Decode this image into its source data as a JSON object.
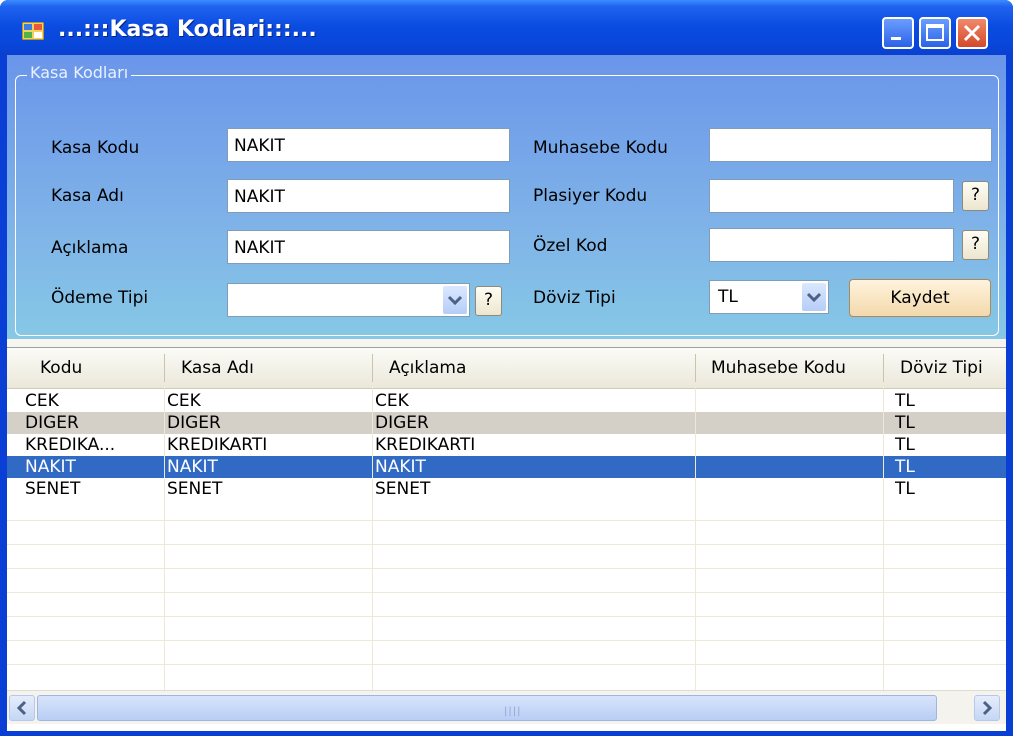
{
  "window": {
    "title": "...:::Kasa Kodlari:::..."
  },
  "group": {
    "legend": "Kasa Kodları"
  },
  "form": {
    "kasa_kodu_label": "Kasa Kodu",
    "kasa_kodu_value": "NAKIT",
    "kasa_adi_label": "Kasa Adı",
    "kasa_adi_value": "NAKIT",
    "aciklama_label": "Açıklama",
    "aciklama_value": "NAKIT",
    "odeme_tipi_label": "Ödeme Tipi",
    "odeme_tipi_value": "",
    "muhasebe_kodu_label": "Muhasebe Kodu",
    "muhasebe_kodu_value": "",
    "plasiyer_kodu_label": "Plasiyer Kodu",
    "plasiyer_kodu_value": "",
    "ozel_kod_label": "Özel Kod",
    "ozel_kod_value": "",
    "doviz_tipi_label": "Döviz Tipi",
    "doviz_tipi_value": "TL",
    "help_label": "?",
    "save_label": "Kaydet"
  },
  "grid": {
    "columns": [
      "Kodu",
      "Kasa Adı",
      "Açıklama",
      "Muhasebe Kodu",
      "Döviz Tipi"
    ],
    "rows": [
      [
        "CEK",
        "CEK",
        "CEK",
        "",
        "TL"
      ],
      [
        "DIGER",
        "DIGER",
        "DIGER",
        "",
        "TL"
      ],
      [
        "KREDIKA...",
        "KREDIKARTI",
        "KREDIKARTI",
        "",
        "TL"
      ],
      [
        "NAKIT",
        "NAKIT",
        "NAKIT",
        "",
        "TL"
      ],
      [
        "SENET",
        "SENET",
        "SENET",
        "",
        "TL"
      ]
    ],
    "selected_row": 3
  },
  "icons": {
    "app": "app-window-icon",
    "minimize": "minimize-icon",
    "maximize": "maximize-icon",
    "close": "close-icon",
    "dropdown": "chevron-down-icon",
    "scroll_left": "chevron-left-icon",
    "scroll_right": "chevron-right-icon"
  },
  "colors": {
    "titlebar": "#0a4be0",
    "selection": "#316ac5",
    "close_button": "#d4482a",
    "save_button": "#f3d9ac"
  }
}
